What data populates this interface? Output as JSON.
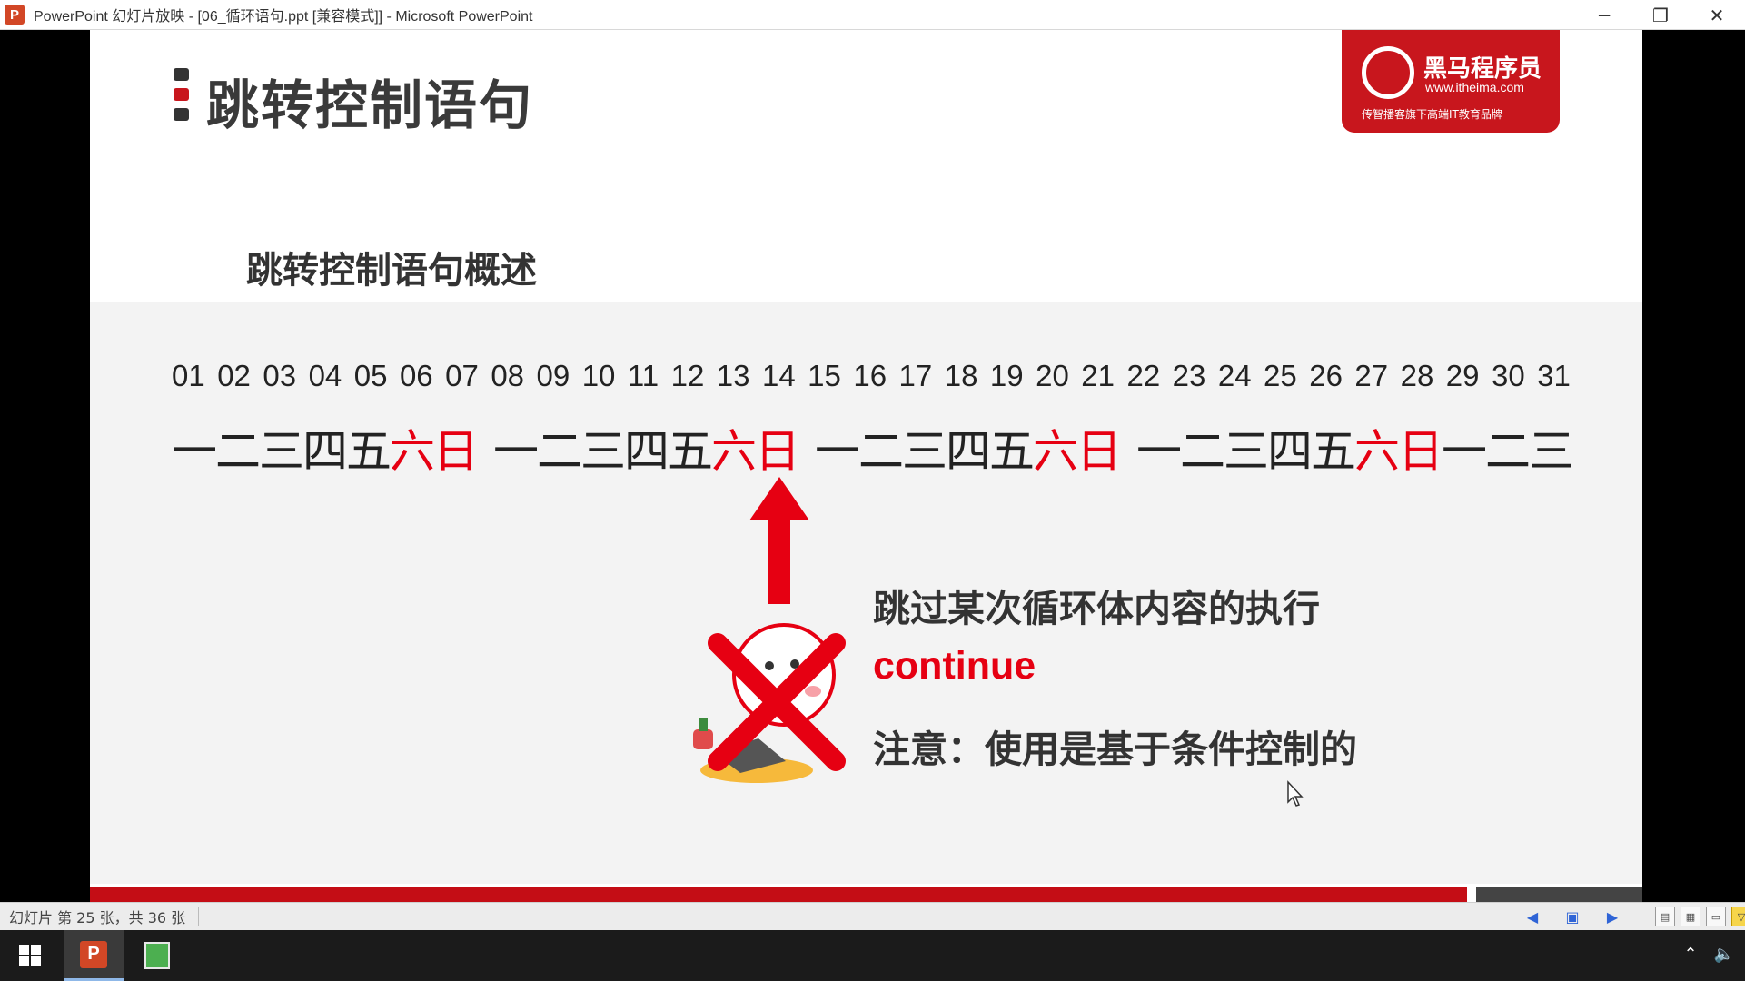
{
  "window": {
    "title": "PowerPoint 幻灯片放映 - [06_循环语句.ppt [兼容模式]] - Microsoft PowerPoint",
    "app_icon_letter": "P",
    "controls": {
      "minimize": "─",
      "restore": "❐",
      "close": "✕"
    }
  },
  "slide": {
    "title": "跳转控制语句",
    "subtitle": "跳转控制语句概述",
    "logo": {
      "name": "黑马程序员",
      "url": "www.itheima.com",
      "tagline": "传智播客旗下高端IT教育品牌"
    },
    "numbers": [
      "01",
      "02",
      "03",
      "04",
      "05",
      "06",
      "07",
      "08",
      "09",
      "10",
      "11",
      "12",
      "13",
      "14",
      "15",
      "16",
      "17",
      "18",
      "19",
      "20",
      "21",
      "22",
      "23",
      "24",
      "25",
      "26",
      "27",
      "28",
      "29",
      "30",
      "31"
    ],
    "weeks": [
      {
        "weekday": "一二三四五",
        "weekend": "六日"
      },
      {
        "weekday": "一二三四五",
        "weekend": "六日"
      },
      {
        "weekday": "一二三四五",
        "weekend": "六日"
      },
      {
        "weekday": "一二三四五",
        "weekend": "六日"
      },
      {
        "weekday": "一二三",
        "weekend": ""
      }
    ],
    "text_lines": {
      "description": "跳过某次循环体内容的执行",
      "keyword": "continue",
      "note": "注意：使用是基于条件控制的"
    },
    "colors": {
      "accent_red": "#e60012",
      "brand_red": "#c8161d",
      "title_dark": "#3a3a3a"
    }
  },
  "status": {
    "slide_info": "幻灯片 第 25 张，共 36 张"
  },
  "taskbar": {
    "items": [
      "start-icon",
      "powerpoint-icon",
      "projector-icon"
    ],
    "tray": [
      "chevron-up-icon",
      "volume-icon"
    ]
  }
}
